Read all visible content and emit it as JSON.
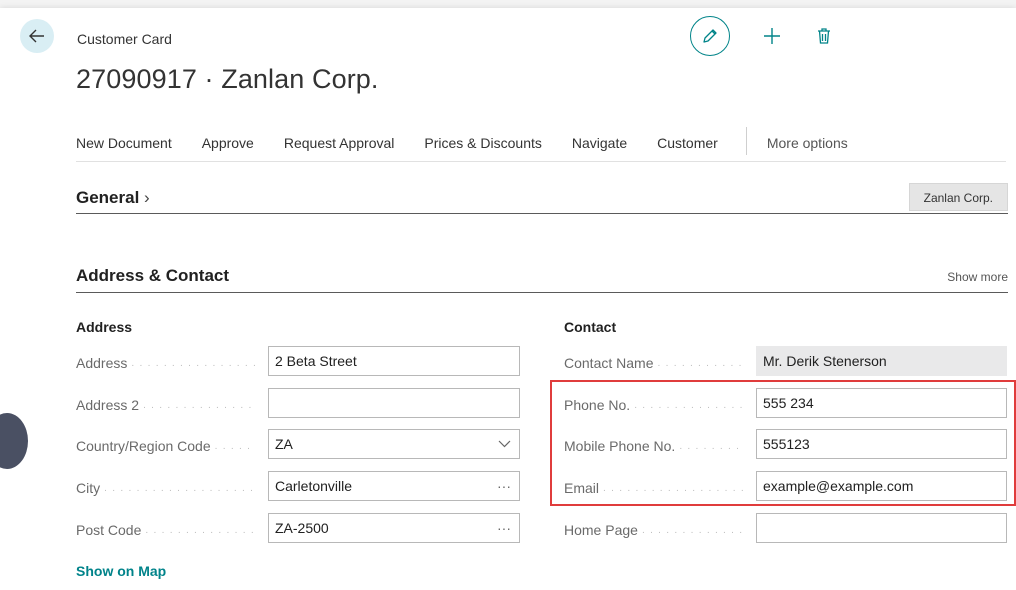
{
  "header": {
    "caption": "Customer Card",
    "title": "27090917 · Zanlan Corp."
  },
  "actions": [
    "New Document",
    "Approve",
    "Request Approval",
    "Prices & Discounts",
    "Navigate",
    "Customer"
  ],
  "more_options": "More options",
  "general": {
    "heading": "General",
    "tag": "Zanlan Corp."
  },
  "address_contact": {
    "heading": "Address & Contact",
    "show_more": "Show more",
    "address": {
      "title": "Address",
      "fields": [
        {
          "label": "Address",
          "value": "2 Beta Street",
          "suffix": ""
        },
        {
          "label": "Address 2",
          "value": "",
          "suffix": ""
        },
        {
          "label": "Country/Region Code",
          "value": "ZA",
          "suffix": "chevron-down"
        },
        {
          "label": "City",
          "value": "Carletonville",
          "suffix": "···"
        },
        {
          "label": "Post Code",
          "value": "ZA-2500",
          "suffix": "···"
        }
      ],
      "show_on_map": "Show on Map"
    },
    "contact": {
      "title": "Contact",
      "fields": [
        {
          "label": "Contact Name",
          "value": "Mr. Derik Stenerson",
          "readonly": true
        },
        {
          "label": "Phone No.",
          "value": "555 234"
        },
        {
          "label": "Mobile Phone No.",
          "value": "555123"
        },
        {
          "label": "Email",
          "value": "example@example.com"
        },
        {
          "label": "Home Page",
          "value": ""
        }
      ]
    }
  },
  "colors": {
    "accent": "#008489",
    "highlight": "#e03c3c",
    "back_button_bg": "#d9eef4"
  }
}
